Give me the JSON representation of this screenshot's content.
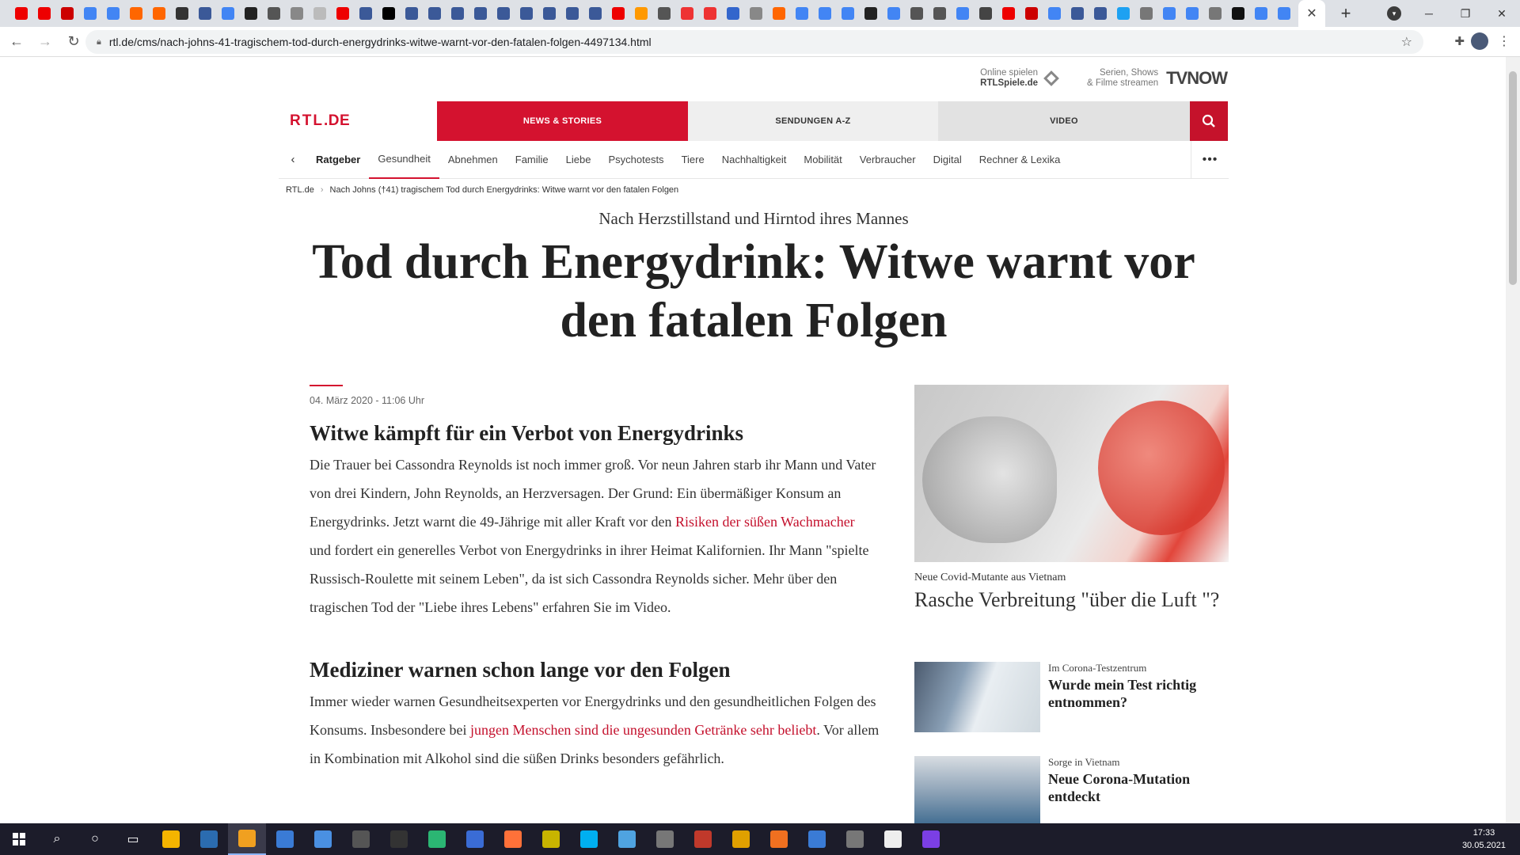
{
  "browser": {
    "url": "rtl.de/cms/nach-johns-41-tragischem-tod-durch-energydrinks-witwe-warnt-vor-den-fatalen-folgen-4497134.html",
    "tab_colors": [
      "#e00",
      "#e00",
      "#c00",
      "#4285f4",
      "#4285f4",
      "#f60",
      "#f60",
      "#333",
      "#3b5998",
      "#4285f4",
      "#222",
      "#555",
      "#888",
      "#bbb",
      "#e00",
      "#3b5998",
      "#000",
      "#3b5998",
      "#3b5998",
      "#3b5998",
      "#3b5998",
      "#3b5998",
      "#3b5998",
      "#3b5998",
      "#3b5998",
      "#3b5998",
      "#e00",
      "#f90",
      "#555",
      "#e33",
      "#e33",
      "#3366cc",
      "#888",
      "#f60",
      "#4285f4",
      "#4285f4",
      "#4285f4",
      "#222",
      "#4285f4",
      "#555",
      "#555",
      "#4285f4",
      "#444",
      "#e00",
      "#c00",
      "#4285f4",
      "#3b5998",
      "#3b5998",
      "#1da1f2",
      "#777",
      "#4285f4",
      "#4285f4",
      "#777",
      "#111",
      "#4285f4",
      "#4285f4"
    ]
  },
  "site": {
    "logo_main": "RTL",
    "logo_suffix": ".DE",
    "top_links": [
      {
        "line1": "Online spielen",
        "line2": "RTLSpiele.de"
      },
      {
        "line1": "Serien, Shows",
        "line2": "& Filme streamen",
        "brand": "TVNOW"
      }
    ],
    "nav": [
      "NEWS & STORIES",
      "SENDUNGEN A-Z",
      "VIDEO"
    ],
    "subnav": [
      "Ratgeber",
      "Gesundheit",
      "Abnehmen",
      "Familie",
      "Liebe",
      "Psychotests",
      "Tiere",
      "Nachhaltigkeit",
      "Mobilität",
      "Verbraucher",
      "Digital",
      "Rechner & Lexika"
    ],
    "accent_color": "#d4122f"
  },
  "breadcrumb": {
    "home": "RTL.de",
    "current": "Nach Johns (†41) tragischem Tod durch Energydrinks: Witwe warnt vor den fatalen Folgen"
  },
  "article": {
    "kicker": "Nach Herzstillstand und Hirntod ihres Mannes",
    "headline": "Tod durch Energydrink: Witwe warnt vor den fatalen Folgen",
    "date": "04. März 2020 - 11:06 Uhr",
    "section1_title": "Witwe kämpft für ein Verbot von Energydrinks",
    "section1_p_a": "Die Trauer bei Cassondra Reynolds ist noch immer groß. Vor neun Jahren starb ihr Mann und Vater von drei Kindern, John Reynolds, an Herzversagen. Der Grund: Ein übermäßiger Konsum an Energydrinks. Jetzt warnt die 49-Jährige mit aller Kraft vor den ",
    "section1_link": "Risiken der süßen Wachmacher",
    "section1_p_b": " und fordert ein generelles Verbot von Energydrinks in ihrer Heimat Kalifornien. Ihr Mann \"spielte Russisch-Roulette mit seinem Leben\", da ist sich Cassondra Reynolds sicher. Mehr über den tragischen Tod der \"Liebe ihres Lebens\" erfahren Sie im Video.",
    "section2_title": "Mediziner warnen schon lange vor den Folgen",
    "section2_p_a": "Immer wieder warnen Gesundheitsexperten vor Energydrinks und den gesundheitlichen Folgen des Konsums. Insbesondere bei ",
    "section2_link": "jungen Menschen sind die ungesunden Getränke sehr beliebt",
    "section2_p_b": ". Vor allem in Kombination mit Alkohol sind die süßen Drinks besonders gefährlich."
  },
  "sidebar": {
    "hero_kicker": "Neue Covid-Mutante aus Vietnam",
    "hero_title": "Rasche Verbreitung \"über die Luft \"?",
    "teasers": [
      {
        "kicker": "Im Corona-Testzentrum",
        "title": "Wurde mein Test richtig entnommen?"
      },
      {
        "kicker": "Sorge in Vietnam",
        "title": "Neue Corona-Mutation entdeckt"
      }
    ]
  },
  "taskbar": {
    "time": "17:33",
    "date": "30.05.2021",
    "icon_colors": [
      "#f4b400",
      "#2b6cb0",
      "#f0a020",
      "#3a7bd5",
      "#4a90e2",
      "#555",
      "#333",
      "#2bb673",
      "#3a6cd5",
      "#ff7139",
      "#c8b400",
      "#00aff0",
      "#4fa3e0",
      "#777",
      "#c0392b",
      "#e0a000",
      "#f07020",
      "#3a7bd5",
      "#777",
      "#eee",
      "#7b3fe4"
    ]
  }
}
